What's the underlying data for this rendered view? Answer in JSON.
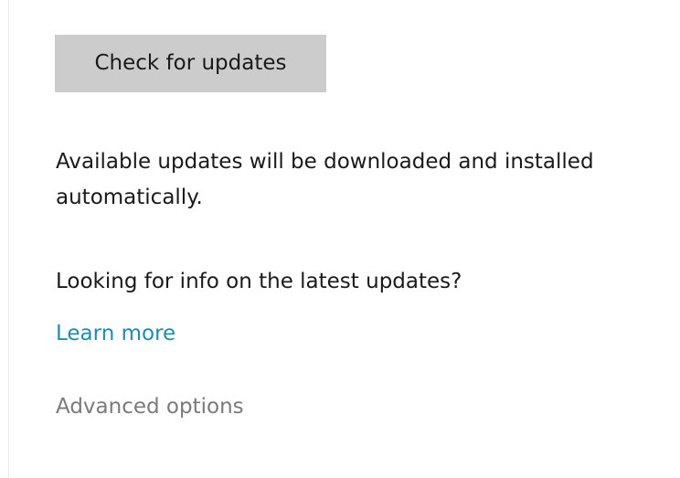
{
  "update": {
    "check_button_label": "Check for updates",
    "description_line1": "Available updates will be downloaded and installed",
    "description_line2": "automatically.",
    "info_question": "Looking for info on the latest updates?",
    "learn_more_link": "Learn more",
    "advanced_options_link": "Advanced options"
  },
  "colors": {
    "button_bg": "#cccccc",
    "link": "#1f8bb5",
    "muted_link": "#7a7a7a",
    "text": "#1a1a1a"
  }
}
